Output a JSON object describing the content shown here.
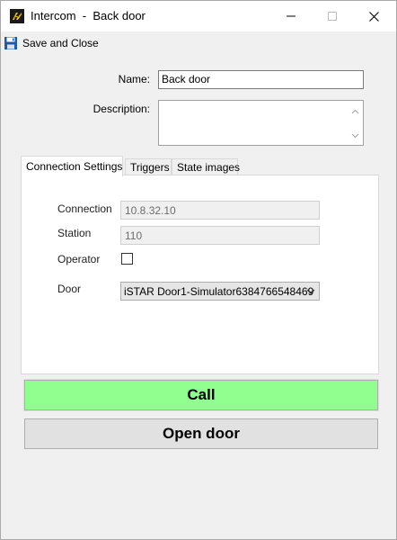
{
  "window": {
    "title": "Intercom  -  Back door"
  },
  "toolbar": {
    "save_close_label": "Save and Close"
  },
  "form": {
    "name_label": "Name:",
    "name_value": "Back door",
    "description_label": "Description:",
    "description_value": ""
  },
  "tabs": [
    {
      "label": "Connection Settings",
      "active": true
    },
    {
      "label": "Triggers",
      "active": false
    },
    {
      "label": "State images",
      "active": false
    }
  ],
  "connection_settings": {
    "connection_label": "Connection",
    "connection_value": "10.8.32.10",
    "station_label": "Station",
    "station_value": "110",
    "operator_label": "Operator",
    "operator_checked": false,
    "door_label": "Door",
    "door_value": "iSTAR Door1-Simulator6384766548469"
  },
  "actions": {
    "call_label": "Call",
    "call_color": "#90ff90",
    "open_door_label": "Open door"
  },
  "colors": {
    "app_icon_accent": "#f5c400",
    "save_icon": "#1e5aa8"
  }
}
